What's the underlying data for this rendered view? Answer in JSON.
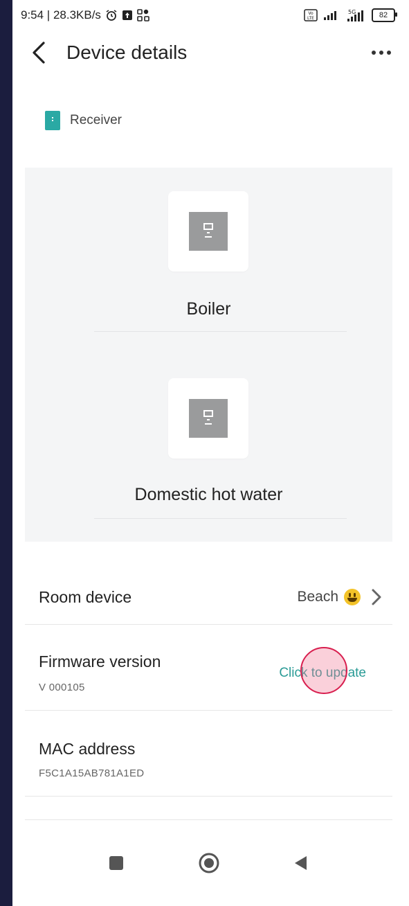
{
  "status_bar": {
    "time_speed": "9:54 | 28.3KB/s",
    "network_5g": "5G",
    "battery": "82",
    "volte": "Vo LTE"
  },
  "header": {
    "title": "Device details",
    "back_icon": "chevron-left-icon",
    "more_icon": "more-horizontal-icon"
  },
  "device_type": {
    "label": "Receiver",
    "icon": "receiver-icon",
    "icon_color": "#2aa9a4"
  },
  "functions": [
    {
      "label": "Boiler",
      "icon": "boiler-icon"
    },
    {
      "label": "Domestic hot water",
      "icon": "boiler-icon"
    }
  ],
  "details": {
    "room_device": {
      "title": "Room device",
      "value": "Beach",
      "emoji": "smiley-emoji"
    },
    "firmware": {
      "title": "Firmware version",
      "version": "V 000105",
      "action": "Click to update"
    },
    "mac": {
      "title": "MAC address",
      "value": "F5C1A15AB781A1ED"
    }
  },
  "colors": {
    "accent": "#2aa9a4",
    "panel_bg": "#f4f5f6",
    "frame_bg": "#1b1d3e",
    "touch_indicator": "#d81e4e"
  }
}
